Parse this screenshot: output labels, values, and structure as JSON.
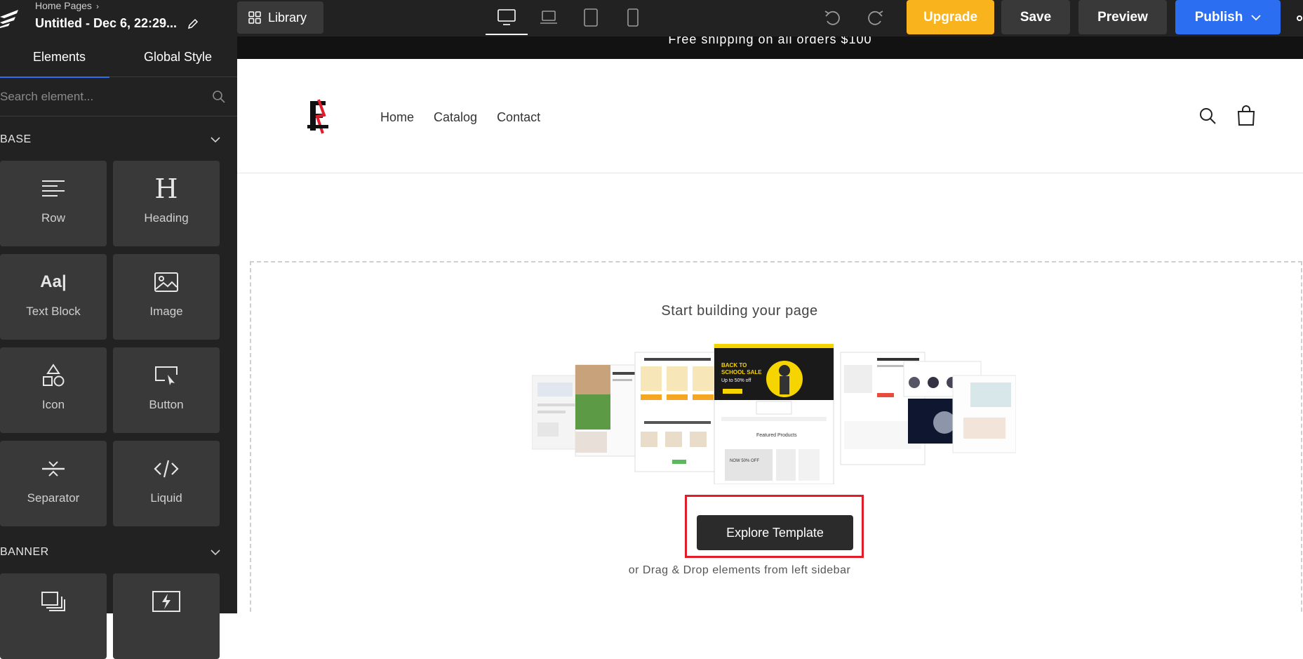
{
  "topbar": {
    "breadcrumb": "Home Pages",
    "doc_title": "Untitled - Dec 6, 22:29...",
    "library_label": "Library",
    "devices": [
      "desktop",
      "laptop",
      "tablet",
      "mobile"
    ],
    "upgrade_label": "Upgrade",
    "save_label": "Save",
    "preview_label": "Preview",
    "publish_label": "Publish"
  },
  "sidebar": {
    "tabs": [
      "Elements",
      "Global Style"
    ],
    "search_placeholder": "Search element...",
    "sections": [
      {
        "title": "BASE",
        "items": [
          "Row",
          "Heading",
          "Text Block",
          "Image",
          "Icon",
          "Button",
          "Separator",
          "Liquid"
        ]
      },
      {
        "title": "BANNER"
      }
    ]
  },
  "canvas": {
    "announcement": "Free shipping on all orders $100",
    "nav": [
      "Home",
      "Catalog",
      "Contact"
    ],
    "start_title": "Start building your page",
    "explore_label": "Explore Template",
    "or_text": "or Drag & Drop elements from left sidebar",
    "template_text": {
      "sale": "BACK TO SCHOOL SALE",
      "sale_sub": "Up to 50% off",
      "featured": "Featured Products",
      "promo": "NOW 50% OFF"
    }
  },
  "colors": {
    "topbar_bg": "#222222",
    "tile_bg": "#393939",
    "upgrade": "#f9b31c",
    "publish": "#2c6ef2",
    "highlight": "#e11d2a"
  }
}
